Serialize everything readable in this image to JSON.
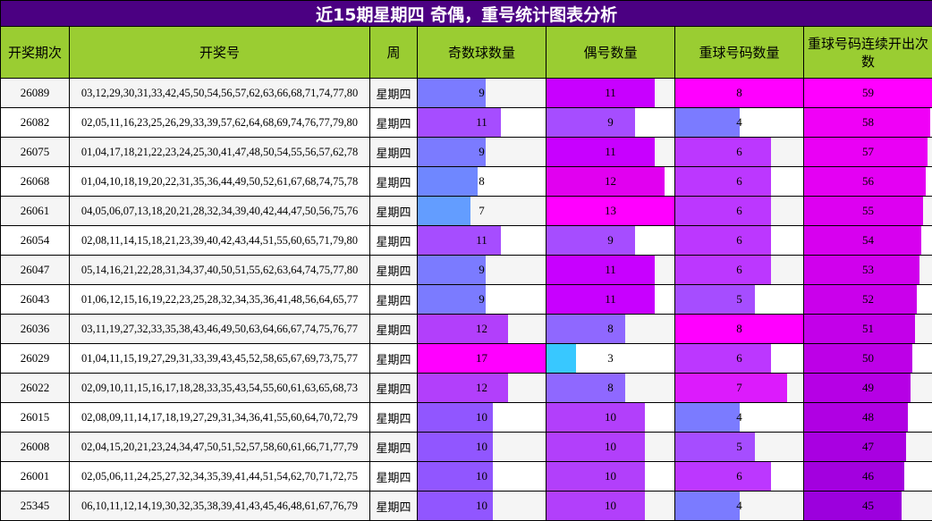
{
  "title": "近15期星期四 奇偶，重号统计图表分析",
  "headers": {
    "period": "开奖期次",
    "numbers": "开奖号",
    "weekday": "周",
    "odd": "奇数球数量",
    "even": "偶号数量",
    "repeat": "重球号码数量",
    "streak": "重球号码连续开出次数"
  },
  "scales": {
    "odd_max": 17,
    "even_max": 13,
    "repeat_max": 8,
    "streak_max": 59
  },
  "rows": [
    {
      "period": "26089",
      "numbers": "03,12,29,30,31,33,42,45,50,54,56,57,62,63,66,68,71,74,77,80",
      "weekday": "星期四",
      "odd": 9,
      "even": 11,
      "repeat": 8,
      "streak": 59,
      "odd_color": "#7b7bff",
      "even_color": "#c800ff",
      "repeat_color": "#ff00ff",
      "streak_color": "#ff00ff"
    },
    {
      "period": "26082",
      "numbers": "02,05,11,16,23,25,26,29,33,39,57,62,64,68,69,74,76,77,79,80",
      "weekday": "星期四",
      "odd": 11,
      "even": 9,
      "repeat": 4,
      "streak": 58,
      "odd_color": "#a64dff",
      "even_color": "#a64dff",
      "repeat_color": "#7b7bff",
      "streak_color": "#f000f7"
    },
    {
      "period": "26075",
      "numbers": "01,04,17,18,21,22,23,24,25,30,41,47,48,50,54,55,56,57,62,78",
      "weekday": "星期四",
      "odd": 9,
      "even": 11,
      "repeat": 6,
      "streak": 57,
      "odd_color": "#7b7bff",
      "even_color": "#c800ff",
      "repeat_color": "#bc37ff",
      "streak_color": "#ea00f5"
    },
    {
      "period": "26068",
      "numbers": "01,04,10,18,19,20,22,31,35,36,44,49,50,52,61,67,68,74,75,78",
      "weekday": "星期四",
      "odd": 8,
      "even": 12,
      "repeat": 6,
      "streak": 56,
      "odd_color": "#6f87ff",
      "even_color": "#e100f0",
      "repeat_color": "#bc37ff",
      "streak_color": "#e400f3"
    },
    {
      "period": "26061",
      "numbers": "04,05,06,07,13,18,20,21,28,32,34,39,40,42,44,47,50,56,75,76",
      "weekday": "星期四",
      "odd": 7,
      "even": 13,
      "repeat": 6,
      "streak": 55,
      "odd_color": "#639dff",
      "even_color": "#ff00ff",
      "repeat_color": "#bc37ff",
      "streak_color": "#dd00f1"
    },
    {
      "period": "26054",
      "numbers": "02,08,11,14,15,18,21,23,39,40,42,43,44,51,55,60,65,71,79,80",
      "weekday": "星期四",
      "odd": 11,
      "even": 9,
      "repeat": 6,
      "streak": 54,
      "odd_color": "#a64dff",
      "even_color": "#a64dff",
      "repeat_color": "#bc37ff",
      "streak_color": "#d700ef"
    },
    {
      "period": "26047",
      "numbers": "05,14,16,21,22,28,31,34,37,40,50,51,55,62,63,64,74,75,77,80",
      "weekday": "星期四",
      "odd": 9,
      "even": 11,
      "repeat": 6,
      "streak": 53,
      "odd_color": "#7b7bff",
      "even_color": "#c800ff",
      "repeat_color": "#bc37ff",
      "streak_color": "#d000ed"
    },
    {
      "period": "26043",
      "numbers": "01,06,12,15,16,19,22,23,25,28,32,34,35,36,41,48,56,64,65,77",
      "weekday": "星期四",
      "odd": 9,
      "even": 11,
      "repeat": 5,
      "streak": 52,
      "odd_color": "#7b7bff",
      "even_color": "#c800ff",
      "repeat_color": "#a64dff",
      "streak_color": "#ca00eb"
    },
    {
      "period": "26036",
      "numbers": "03,11,19,27,32,33,35,38,43,46,49,50,63,64,66,67,74,75,76,77",
      "weekday": "星期四",
      "odd": 12,
      "even": 8,
      "repeat": 8,
      "streak": 51,
      "odd_color": "#b23ffb",
      "even_color": "#8f68ff",
      "repeat_color": "#ff00ff",
      "streak_color": "#c300e9"
    },
    {
      "period": "26029",
      "numbers": "01,04,11,15,19,27,29,31,33,39,43,45,52,58,65,67,69,73,75,77",
      "weekday": "星期四",
      "odd": 17,
      "even": 3,
      "repeat": 6,
      "streak": 50,
      "odd_color": "#ff00ff",
      "even_color": "#38c8ff",
      "repeat_color": "#bc37ff",
      "streak_color": "#bd00e7"
    },
    {
      "period": "26022",
      "numbers": "02,09,10,11,15,16,17,18,28,33,35,43,54,55,60,61,63,65,68,73",
      "weekday": "星期四",
      "odd": 12,
      "even": 8,
      "repeat": 7,
      "streak": 49,
      "odd_color": "#b23ffb",
      "even_color": "#8f68ff",
      "repeat_color": "#dc1bfc",
      "streak_color": "#b600e5"
    },
    {
      "period": "26015",
      "numbers": "02,08,09,11,14,17,18,19,27,29,31,34,36,41,55,60,64,70,72,79",
      "weekday": "星期四",
      "odd": 10,
      "even": 10,
      "repeat": 4,
      "streak": 48,
      "odd_color": "#9156ff",
      "even_color": "#b23ffb",
      "repeat_color": "#7b7bff",
      "streak_color": "#b000e3"
    },
    {
      "period": "26008",
      "numbers": "02,04,15,20,21,23,24,34,47,50,51,52,57,58,60,61,66,71,77,79",
      "weekday": "星期四",
      "odd": 10,
      "even": 10,
      "repeat": 5,
      "streak": 47,
      "odd_color": "#9156ff",
      "even_color": "#b23ffb",
      "repeat_color": "#a64dff",
      "streak_color": "#a900e1"
    },
    {
      "period": "26001",
      "numbers": "02,05,06,11,24,25,27,32,34,35,39,41,44,51,54,62,70,71,72,75",
      "weekday": "星期四",
      "odd": 10,
      "even": 10,
      "repeat": 6,
      "streak": 46,
      "odd_color": "#9156ff",
      "even_color": "#b23ffb",
      "repeat_color": "#bc37ff",
      "streak_color": "#a300df"
    },
    {
      "period": "25345",
      "numbers": "06,10,11,12,14,19,30,32,35,38,39,41,43,45,46,48,61,67,76,79",
      "weekday": "星期四",
      "odd": 10,
      "even": 10,
      "repeat": 4,
      "streak": 45,
      "odd_color": "#9156ff",
      "even_color": "#b23ffb",
      "repeat_color": "#7b7bff",
      "streak_color": "#9c00dd"
    }
  ]
}
